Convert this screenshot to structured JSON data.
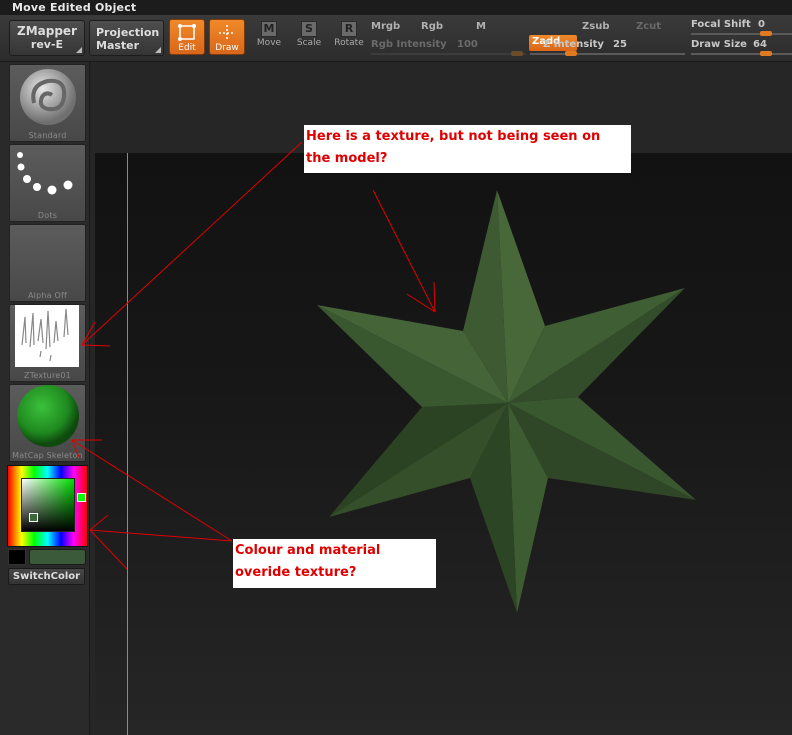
{
  "window": {
    "title": "Move Edited Object"
  },
  "toolbar": {
    "zmapper": {
      "line1": "ZMapper",
      "line2": "rev-E"
    },
    "projection": {
      "line1": "Projection",
      "line2": "Master"
    },
    "edit_label": "Edit",
    "draw_label": "Draw",
    "move": {
      "glyph": "M",
      "label": "Move"
    },
    "scale": {
      "glyph": "S",
      "label": "Scale"
    },
    "rotate": {
      "glyph": "R",
      "label": "Rotate"
    },
    "mrgb": "Mrgb",
    "rgb": "Rgb",
    "m": "M",
    "rgb_intensity": {
      "label": "Rgb Intensity",
      "value": "100"
    },
    "zadd": "Zadd",
    "zsub": "Zsub",
    "zcut": "Zcut",
    "z_intensity": {
      "label": "Z Intensity",
      "value": "25",
      "level": 0.25
    },
    "focal_shift": {
      "label": "Focal Shift",
      "value": "0"
    },
    "draw_size": {
      "label": "Draw Size",
      "value": "64"
    }
  },
  "left_panel": {
    "brush_label": "Standard",
    "stroke_label": "Dots",
    "alpha_label": "Alpha Off",
    "texture_label": "ZTexture01",
    "material_label": "MatCap Skeleton",
    "switch_color": "SwitchColor"
  },
  "annotations": {
    "note1": "Here is a texture, but not being seen on the model?",
    "note2": "Colour and material overide texture?"
  },
  "colors": {
    "accent": "#e8781e",
    "model_green": "#3e5a32",
    "material_green": "#2e9a2e",
    "annotation_red": "#e00000"
  }
}
